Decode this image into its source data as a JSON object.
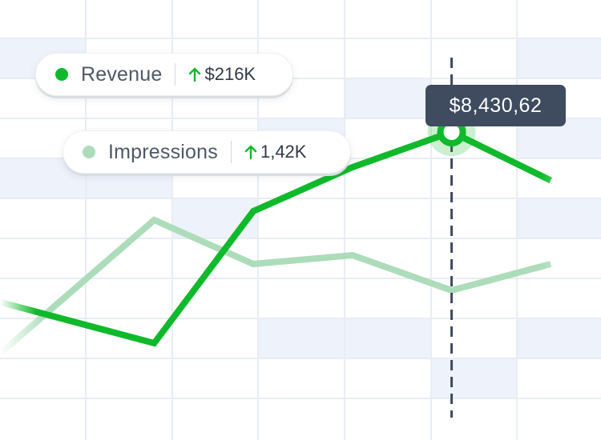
{
  "colors": {
    "revenue": "#10b92b",
    "impressions": "#acdcba",
    "grid": "#e8edf4",
    "cell": "#edf2fb",
    "crosshair": "#3f4b5e",
    "tooltip_bg": "#3f4b5e"
  },
  "legend": [
    {
      "name": "Revenue",
      "delta": "$216K",
      "arrow_icon": "arrow-up-icon"
    },
    {
      "name": "Impressions",
      "delta": "1,42K",
      "arrow_icon": "arrow-up-icon"
    }
  ],
  "tooltip": {
    "value": "$8,430,62"
  },
  "chart_data": {
    "type": "line",
    "grid": true,
    "legend_position": "top-left",
    "x": [
      0,
      1,
      2,
      3,
      4,
      5,
      6,
      7
    ],
    "xlim": [
      0,
      7
    ],
    "ylim": [
      0,
      100
    ],
    "series": [
      {
        "name": "Revenue",
        "values": [
          34,
          null,
          22,
          52,
          62,
          70,
          59,
          null
        ]
      },
      {
        "name": "Impressions",
        "values": [
          11,
          null,
          50,
          40,
          42,
          34,
          40,
          null
        ]
      }
    ],
    "highlight": {
      "series": "Revenue",
      "index": 5,
      "label": "$8,430,62"
    }
  }
}
